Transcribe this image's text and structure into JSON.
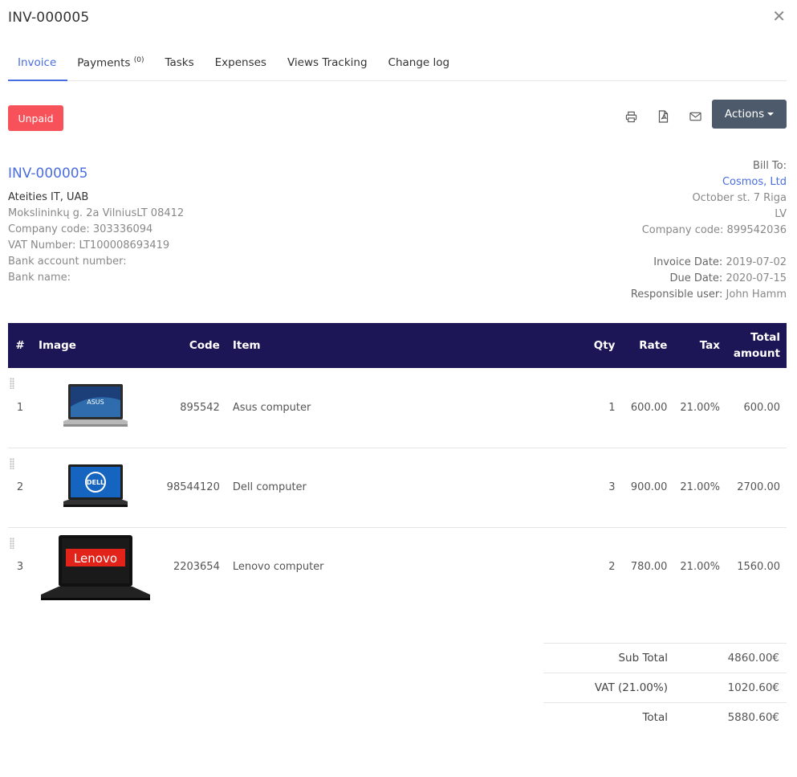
{
  "header": {
    "title": "INV-000005",
    "close_icon": "close-icon"
  },
  "tabs": [
    {
      "label": "Invoice",
      "active": true
    },
    {
      "label": "Payments",
      "count": "(0)"
    },
    {
      "label": "Tasks"
    },
    {
      "label": "Expenses"
    },
    {
      "label": "Views Tracking"
    },
    {
      "label": "Change log"
    }
  ],
  "status": {
    "label": "Unpaid",
    "color": "#f7525a"
  },
  "toolbar": {
    "print_icon": "print-icon",
    "pdf_icon": "pdf-icon",
    "email_icon": "email-icon",
    "actions_label": "Actions"
  },
  "invoice": {
    "number": "INV-000005",
    "from": {
      "company": "Ateities IT, UAB",
      "address": "Mokslininkų g. 2a VilniusLT 08412",
      "company_code": "Company code: 303336094",
      "vat_number": "VAT Number: LT100008693419",
      "bank_account": "Bank account number:",
      "bank_name": "Bank name:"
    },
    "bill_to": {
      "label": "Bill To:",
      "client": "Cosmos, Ltd",
      "address": "October st. 7 Riga",
      "country": "LV",
      "company_code": "Company code: 899542036"
    },
    "invoice_date_label": "Invoice Date:",
    "invoice_date": "2019-07-02",
    "due_date_label": "Due Date:",
    "due_date": "2020-07-15",
    "responsible_label": "Responsible user:",
    "responsible": "John Hamm"
  },
  "table": {
    "headers": {
      "num": "#",
      "image": "Image",
      "code": "Code",
      "item": "Item",
      "qty": "Qty",
      "rate": "Rate",
      "tax": "Tax",
      "total_1": "Total",
      "total_2": "amount"
    },
    "rows": [
      {
        "num": "1",
        "image": "asus-laptop-image",
        "brand": "ASUS",
        "code": "895542",
        "item": "Asus computer",
        "qty": "1",
        "rate": "600.00",
        "tax": "21.00%",
        "total": "600.00"
      },
      {
        "num": "2",
        "image": "dell-laptop-image",
        "brand": "DELL",
        "code": "98544120",
        "item": "Dell computer",
        "qty": "3",
        "rate": "900.00",
        "tax": "21.00%",
        "total": "2700.00"
      },
      {
        "num": "3",
        "image": "lenovo-laptop-image",
        "brand": "Lenovo",
        "code": "2203654",
        "item": "Lenovo computer",
        "qty": "2",
        "rate": "780.00",
        "tax": "21.00%",
        "total": "1560.00"
      }
    ]
  },
  "totals": {
    "subtotal_label": "Sub Total",
    "subtotal": "4860.00€",
    "vat_label": "VAT (21.00%)",
    "vat": "1020.60€",
    "total_label": "Total",
    "total": "5880.60€"
  },
  "colors": {
    "accent": "#4a6ee0",
    "table_header": "#1d1656",
    "actions_button": "#4d5a6b"
  }
}
